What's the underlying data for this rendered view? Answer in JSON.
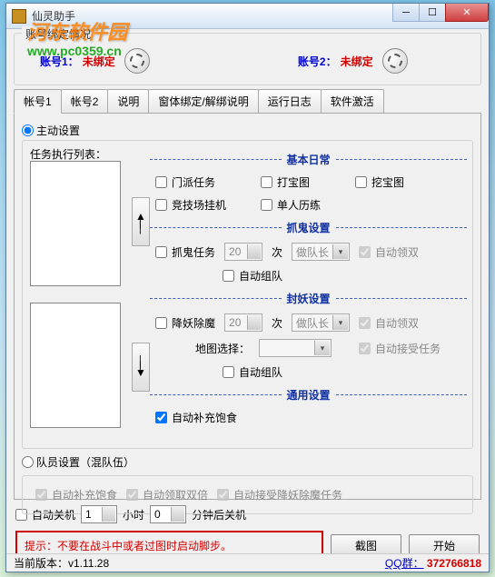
{
  "watermark": {
    "line1": "河东软件园",
    "line2": "www.pc0359.cn"
  },
  "window": {
    "title": "仙灵助手"
  },
  "binding": {
    "group_title": "账号绑定情况",
    "acc1_label": "账号1：",
    "acc1_status": "未绑定",
    "acc2_label": "账号2：",
    "acc2_status": "未绑定"
  },
  "tabs": [
    "帐号1",
    "帐号2",
    "说明",
    "窗体绑定/解绑说明",
    "运行日志",
    "软件激活"
  ],
  "active": {
    "radio": "主动设置",
    "list_label": "任务执行列表：",
    "sections": {
      "basic": {
        "title": "基本日常",
        "items": [
          "门派任务",
          "打宝图",
          "挖宝图",
          "竞技场挂机",
          "单人历练"
        ]
      },
      "ghost": {
        "title": "抓鬼设置",
        "task": "抓鬼任务",
        "count": "20",
        "times": "次",
        "role": "做队长",
        "autodbl": "自动领双",
        "autoteam": "自动组队"
      },
      "monster": {
        "title": "封妖设置",
        "task": "降妖除魔",
        "count": "20",
        "times": "次",
        "role": "做队长",
        "autodbl": "自动领双",
        "maplabel": "地图选择：",
        "autoaccept": "自动接受任务",
        "autoteam": "自动组队"
      },
      "general": {
        "title": "通用设置",
        "autofood": "自动补充饱食"
      }
    }
  },
  "team": {
    "radio": "队员设置（混队伍）",
    "items": [
      "自动补充饱食",
      "自动领取双倍",
      "自动接受降妖除魔任务"
    ]
  },
  "shutdown": {
    "auto": "自动关机",
    "hours": "1",
    "hlabel": "小时",
    "mins": "0",
    "mlabel": "分钟后关机"
  },
  "warn": "提示：不要在战斗中或者过图时启动脚步。",
  "buttons": {
    "shot": "截图",
    "start": "开始"
  },
  "status": {
    "version": "当前版本：v1.11.28",
    "qq_label": "QQ群：",
    "qq_val": "372766818"
  }
}
